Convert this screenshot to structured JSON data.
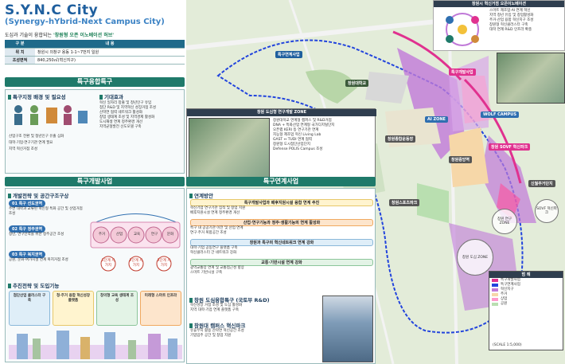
{
  "header": {
    "title": "S.Y.N.C City",
    "subtitle": "(Synergy-hYbrid-Next Campus City)",
    "tagline_prefix": "도심과 기술이 융합되는",
    "tagline_highlight": "'창원형 오픈 이노베이션 허브'"
  },
  "info_table": {
    "col1": "구 분",
    "col2": "내 용",
    "rows": [
      {
        "label": "위 치",
        "value": "창원시 의창구 용동 1-1~7번지 일원"
      },
      {
        "label": "조성면적",
        "value": "840,250㎡(혁신지구)"
      }
    ]
  },
  "left_section": {
    "title": "특구융합특구",
    "block1_title": "특구지정 배경 및 필요성",
    "block1_text": [
      "산업구조 전환 및 청년인구 유출 심화",
      "대학·기업·연구기관 연계 필요",
      "지역 혁신거점 조성"
    ],
    "block2_title": "기대효과",
    "block2_items": [
      "혁신 일자리 창출 및 청년인구 유입",
      "첨단 R&D 및 지역혁신 성장거점 조성",
      "산학연 협력 네트워크 활성화",
      "창업 생태계 조성 및 지역경제 활성화",
      "도시재생 연계 정주환경 개선",
      "지역균형발전 선도모델 구축"
    ]
  },
  "dev_section": {
    "title": "특구개발사업",
    "sub1": "개발전략 및 공간구조구상",
    "stages": [
      {
        "label": "01 특구 선도권역",
        "text": "주변 대학과 교류된 혁신형 특화 공간 및 산업거점 조성"
      },
      {
        "label": "02 특구 정주권역",
        "text": "청년, 연구인력을 위한 정주공간 조성"
      },
      {
        "label": "03 특구 복지권역",
        "text": "공원, 문화·여가시설 연계 복지거점 조성"
      }
    ],
    "circles": [
      "주거",
      "산업",
      "교육",
      "연구",
      "문화"
    ],
    "phases": [
      "1단계 시가지",
      "2단계 시가지",
      "3단계 시가지"
    ],
    "sub2": "추진전략 및 도입기능",
    "functions": [
      "첨단산업 클러스터 구축",
      "청·주거 융합 혁신성장 플랫폼",
      "창의형 교육 생태계 조성",
      "미래형 스마트 인프라"
    ]
  },
  "center_section": {
    "zone_title": "창원 도심형 연구개발 ZONE",
    "bullets": [
      "창원대학교 연계형 캠퍼스 및 R&D거점",
      "DNA + 특화산업 연계형 국가디지털단지",
      "오픈랩 KERI 등 연구기관 연계",
      "지능형 제조업 혁신 Living Lab",
      "GAST ↔ TUDI 연계 협력",
      "창원형 도시첨단산업단지",
      "Defense POLIS Campus 조성"
    ],
    "title": "특구연계사업",
    "sub1": "연계방안",
    "bars": [
      {
        "label": "특구개발사업과 배후지원시설 융합 연계 추진",
        "items": [
          "혁신기업 연구기관 집적 및 창업 지원",
          "배후지원시설 연계 정주환경 개선"
        ]
      },
      {
        "label": "산업·연구기능과 정주·생활기능의 연계 활성화",
        "items": [
          "특구 내 공공기관 이전 및 산업 연계",
          "연구·주거 복합공간 조성"
        ]
      },
      {
        "label": "창원과 특구의 혁신네트워크 연계 강화",
        "items": [
          "대학·기업 공동연구 플랫폼 구축",
          "혁신클러스터 간 네트워크 강화"
        ]
      },
      {
        "label": "교통·기반시설 연계 강화",
        "items": [
          "광역교통망 연계 및 교통접근성 향상",
          "스마트 기반시설 구축"
        ]
      }
    ],
    "proj1": "창원 도심융합특구 (국토부 R&D)",
    "proj1_text": [
      "혁신성장 거점 조성 및 도심 활성화",
      "지역 대학·기업 연계 플랫폼 구축"
    ],
    "proj2": "창원대 캠퍼스 혁신파크",
    "proj2_text": [
      "유휴부지 활용 산학연 혁신공간 조성",
      "기업입주 공간 및 창업 지원"
    ]
  },
  "map": {
    "labels": {
      "district": "특구개발사업",
      "link": "특구연계사업",
      "zone_a": "AI ZONE",
      "campus": "창원대학교",
      "park": "창원 SOVF 혁신파크",
      "sports": "창원종합운동장",
      "stadium": "창원스포츠파크",
      "center": "창원중앙역",
      "res": "신월주거단지",
      "wolf": "WOLF CAMPUS"
    },
    "circles": [
      "창원 도심 ZONE",
      "창원 연구ZONE",
      "SOVF 혁신파크"
    ],
    "right_box_title": "창원시 혁신거점 오픈이노베이션",
    "right_box_items": [
      "스마트 제조업·AI 연계 혁신",
      "지역 청년 유입 및 창업활성화",
      "주거·산업 융합 혁신지구 조성",
      "창원형 혁신클러스터 구축",
      "대학 연계 R&D 인프라 확충"
    ],
    "legend_title": "범 례",
    "legend_items": [
      "특구개발사업",
      "특구연계사업",
      "혁신지구",
      "주거",
      "상업",
      "공원"
    ],
    "bottom_note": "(SCALE 1:5,000)"
  },
  "colors": {
    "primary": "#1f5f9e",
    "accent": "#1f7a6a",
    "pink": "#e0318f",
    "blue_boundary": "#2244dd"
  }
}
